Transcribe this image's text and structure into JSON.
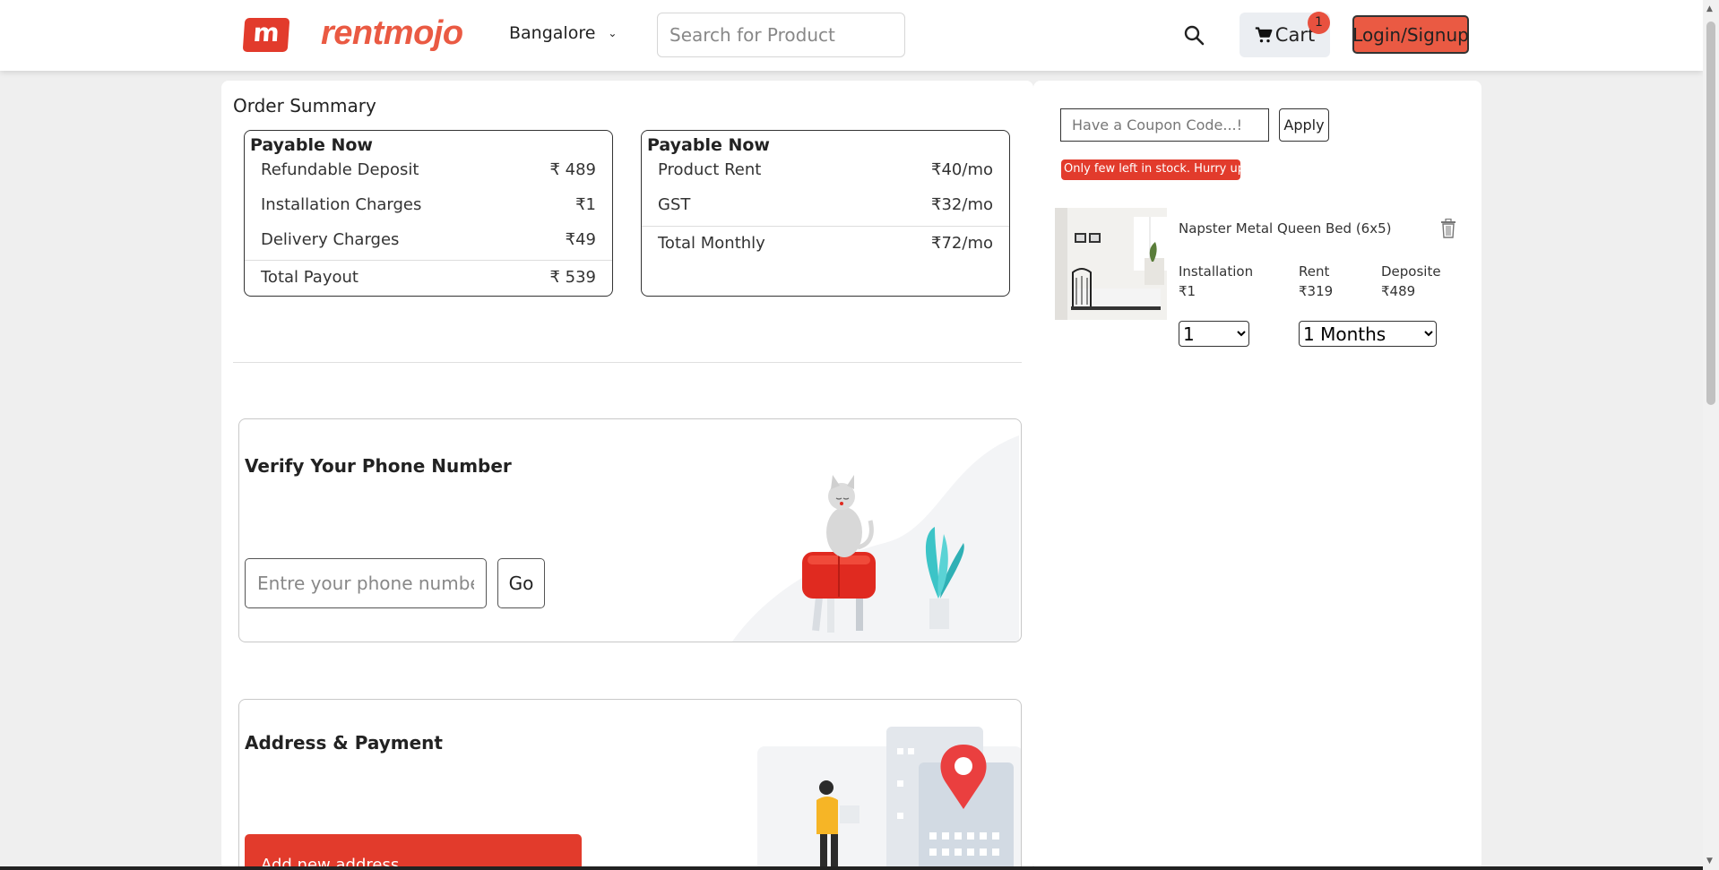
{
  "header": {
    "logo_mark": "m",
    "logo_text": "rentmojo",
    "city": "Bangalore",
    "search_placeholder": "Search for Product",
    "cart_label": "Cart",
    "cart_count": "1",
    "login_label": "Login/Signup"
  },
  "order_summary": {
    "title": "Order Summary",
    "payable_now": {
      "title": "Payable Now",
      "rows": [
        {
          "label": "Refundable Deposit",
          "value": "₹ 489"
        },
        {
          "label": "Installation Charges",
          "value": "₹1"
        },
        {
          "label": "Delivery Charges",
          "value": "₹49"
        }
      ],
      "total": {
        "label": "Total Payout",
        "value": "₹ 539"
      }
    },
    "payable_monthly": {
      "title": "Payable Now",
      "rows": [
        {
          "label": "Product Rent",
          "value": "₹40/mo"
        },
        {
          "label": "GST",
          "value": "₹32/mo"
        }
      ],
      "total": {
        "label": "Total Monthly",
        "value": "₹72/mo"
      }
    }
  },
  "verify_phone": {
    "title": "Verify Your Phone Number",
    "phone_placeholder": "Entre your phone number here",
    "go_label": "Go"
  },
  "address_payment": {
    "title": "Address & Payment",
    "add_address_label": "Add new address"
  },
  "cart_panel": {
    "coupon_placeholder": "Have a Coupon Code...!",
    "apply_label": "Apply",
    "stock_message": "Only few left in stock. Hurry up!",
    "product": {
      "name": "Napster Metal Queen Bed (6x5)",
      "installation_label": "Installation",
      "installation_value": "₹1",
      "rent_label": "Rent",
      "rent_value": "₹319",
      "deposit_label": "Deposite",
      "deposit_value": "₹489",
      "quantity": "1",
      "tenure": "1 Months"
    }
  },
  "colors": {
    "brand_red": "#e23b2c",
    "brand_orange": "#ea5a43"
  }
}
